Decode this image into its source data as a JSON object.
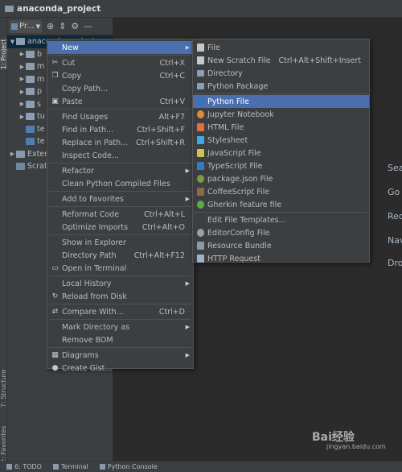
{
  "window": {
    "title": "anaconda_project"
  },
  "left_tabs": {
    "project": "1: Project",
    "structure": "7: Structure",
    "favorites": "2: Favorites"
  },
  "toolbar": {
    "project_view_label": "Pr...",
    "icons": [
      "target-icon",
      "collapse-icon",
      "gear-icon",
      "minimize-icon"
    ]
  },
  "tree": [
    {
      "label": "anaconda_project",
      "arrow": "▼",
      "indent": 0,
      "icon": "folder",
      "selected": true
    },
    {
      "label": "b",
      "arrow": "▶",
      "indent": 1,
      "icon": "folder"
    },
    {
      "label": "m",
      "arrow": "▶",
      "indent": 1,
      "icon": "folder"
    },
    {
      "label": "m",
      "arrow": "▶",
      "indent": 1,
      "icon": "folder"
    },
    {
      "label": "p",
      "arrow": "▶",
      "indent": 1,
      "icon": "folder"
    },
    {
      "label": "s",
      "arrow": "▶",
      "indent": 1,
      "icon": "folder"
    },
    {
      "label": "tu",
      "arrow": "▶",
      "indent": 1,
      "icon": "folder"
    },
    {
      "label": "te",
      "arrow": "",
      "indent": 1,
      "icon": "py"
    },
    {
      "label": "te",
      "arrow": "",
      "indent": 1,
      "icon": "py"
    },
    {
      "label": "Exter",
      "arrow": "▶",
      "indent": 0,
      "icon": "lib"
    },
    {
      "label": "Scrat",
      "arrow": "",
      "indent": 0,
      "icon": "scr"
    }
  ],
  "editor_hints": [
    "Sea",
    "Go",
    "Rec",
    "Nav",
    "Dro"
  ],
  "context_menu": {
    "items": [
      {
        "label": "New",
        "shortcut": "",
        "submenu": true,
        "highlighted": true,
        "icon": ""
      },
      {
        "sep": true
      },
      {
        "label": "Cut",
        "shortcut": "Ctrl+X",
        "icon": "cut-icon",
        "glyph": "✂"
      },
      {
        "label": "Copy",
        "shortcut": "Ctrl+C",
        "icon": "copy-icon",
        "glyph": "❐"
      },
      {
        "label": "Copy Path...",
        "shortcut": ""
      },
      {
        "label": "Paste",
        "shortcut": "Ctrl+V",
        "icon": "paste-icon",
        "glyph": "▣"
      },
      {
        "sep": true
      },
      {
        "label": "Find Usages",
        "shortcut": "Alt+F7"
      },
      {
        "label": "Find in Path...",
        "shortcut": "Ctrl+Shift+F"
      },
      {
        "label": "Replace in Path...",
        "shortcut": "Ctrl+Shift+R"
      },
      {
        "label": "Inspect Code...",
        "shortcut": ""
      },
      {
        "sep": true
      },
      {
        "label": "Refactor",
        "shortcut": "",
        "submenu": true
      },
      {
        "label": "Clean Python Compiled Files",
        "shortcut": ""
      },
      {
        "sep": true
      },
      {
        "label": "Add to Favorites",
        "shortcut": "",
        "submenu": true
      },
      {
        "sep": true
      },
      {
        "label": "Reformat Code",
        "shortcut": "Ctrl+Alt+L"
      },
      {
        "label": "Optimize Imports",
        "shortcut": "Ctrl+Alt+O"
      },
      {
        "sep": true
      },
      {
        "label": "Show in Explorer",
        "shortcut": ""
      },
      {
        "label": "Directory Path",
        "shortcut": "Ctrl+Alt+F12"
      },
      {
        "label": "Open in Terminal",
        "shortcut": "",
        "icon": "terminal-icon",
        "glyph": "▭"
      },
      {
        "sep": true
      },
      {
        "label": "Local History",
        "shortcut": "",
        "submenu": true
      },
      {
        "label": "Reload from Disk",
        "shortcut": "",
        "icon": "reload-icon",
        "glyph": "↻"
      },
      {
        "sep": true
      },
      {
        "label": "Compare With...",
        "shortcut": "Ctrl+D",
        "icon": "compare-icon",
        "glyph": "⇄"
      },
      {
        "sep": true
      },
      {
        "label": "Mark Directory as",
        "shortcut": "",
        "submenu": true
      },
      {
        "label": "Remove BOM",
        "shortcut": ""
      },
      {
        "sep": true
      },
      {
        "label": "Diagrams",
        "shortcut": "",
        "submenu": true,
        "icon": "diagrams-icon",
        "glyph": "▦"
      },
      {
        "label": "Create Gist...",
        "shortcut": "",
        "icon": "github-icon",
        "glyph": "●"
      }
    ]
  },
  "new_submenu": {
    "items": [
      {
        "label": "File",
        "shortcut": "",
        "icon": "file-icon",
        "cls": "ic-file"
      },
      {
        "label": "New Scratch File",
        "shortcut": "Ctrl+Alt+Shift+Insert",
        "icon": "scratch-file-icon",
        "cls": "ic-file"
      },
      {
        "label": "Directory",
        "shortcut": "",
        "icon": "folder-icon",
        "cls": "ic-fold"
      },
      {
        "label": "Python Package",
        "shortcut": "",
        "icon": "package-icon",
        "cls": "ic-fold"
      },
      {
        "sep": true
      },
      {
        "label": "Python File",
        "shortcut": "",
        "icon": "python-icon",
        "cls": "ic-py",
        "highlighted": true
      },
      {
        "label": "Jupyter Notebook",
        "shortcut": "",
        "icon": "jupyter-icon",
        "cls": "ic-jp"
      },
      {
        "label": "HTML File",
        "shortcut": "",
        "icon": "html-icon",
        "cls": "ic-html"
      },
      {
        "label": "Stylesheet",
        "shortcut": "",
        "icon": "css-icon",
        "cls": "ic-css"
      },
      {
        "label": "JavaScript File",
        "shortcut": "",
        "icon": "javascript-icon",
        "cls": "ic-js"
      },
      {
        "label": "TypeScript File",
        "shortcut": "",
        "icon": "typescript-icon",
        "cls": "ic-ts"
      },
      {
        "label": "package.json File",
        "shortcut": "",
        "icon": "json-icon",
        "cls": "ic-json"
      },
      {
        "label": "CoffeeScript File",
        "shortcut": "",
        "icon": "coffeescript-icon",
        "cls": "ic-coffee"
      },
      {
        "label": "Gherkin feature file",
        "shortcut": "",
        "icon": "gherkin-icon",
        "cls": "ic-gherkin"
      },
      {
        "sep": true
      },
      {
        "label": "Edit File Templates...",
        "shortcut": ""
      },
      {
        "label": "EditorConfig File",
        "shortcut": "",
        "icon": "editorconfig-icon",
        "cls": "ic-gear"
      },
      {
        "label": "Resource Bundle",
        "shortcut": "",
        "icon": "resource-bundle-icon",
        "cls": "ic-res"
      },
      {
        "label": "HTTP Request",
        "shortcut": "",
        "icon": "http-icon",
        "cls": "ic-http"
      }
    ]
  },
  "bottom_bar": {
    "todo": "6: TODO",
    "terminal": "Terminal",
    "python_console": "Python Console"
  },
  "watermark": {
    "brand": "Bai经验",
    "url": "jingyan.baidu.com"
  }
}
